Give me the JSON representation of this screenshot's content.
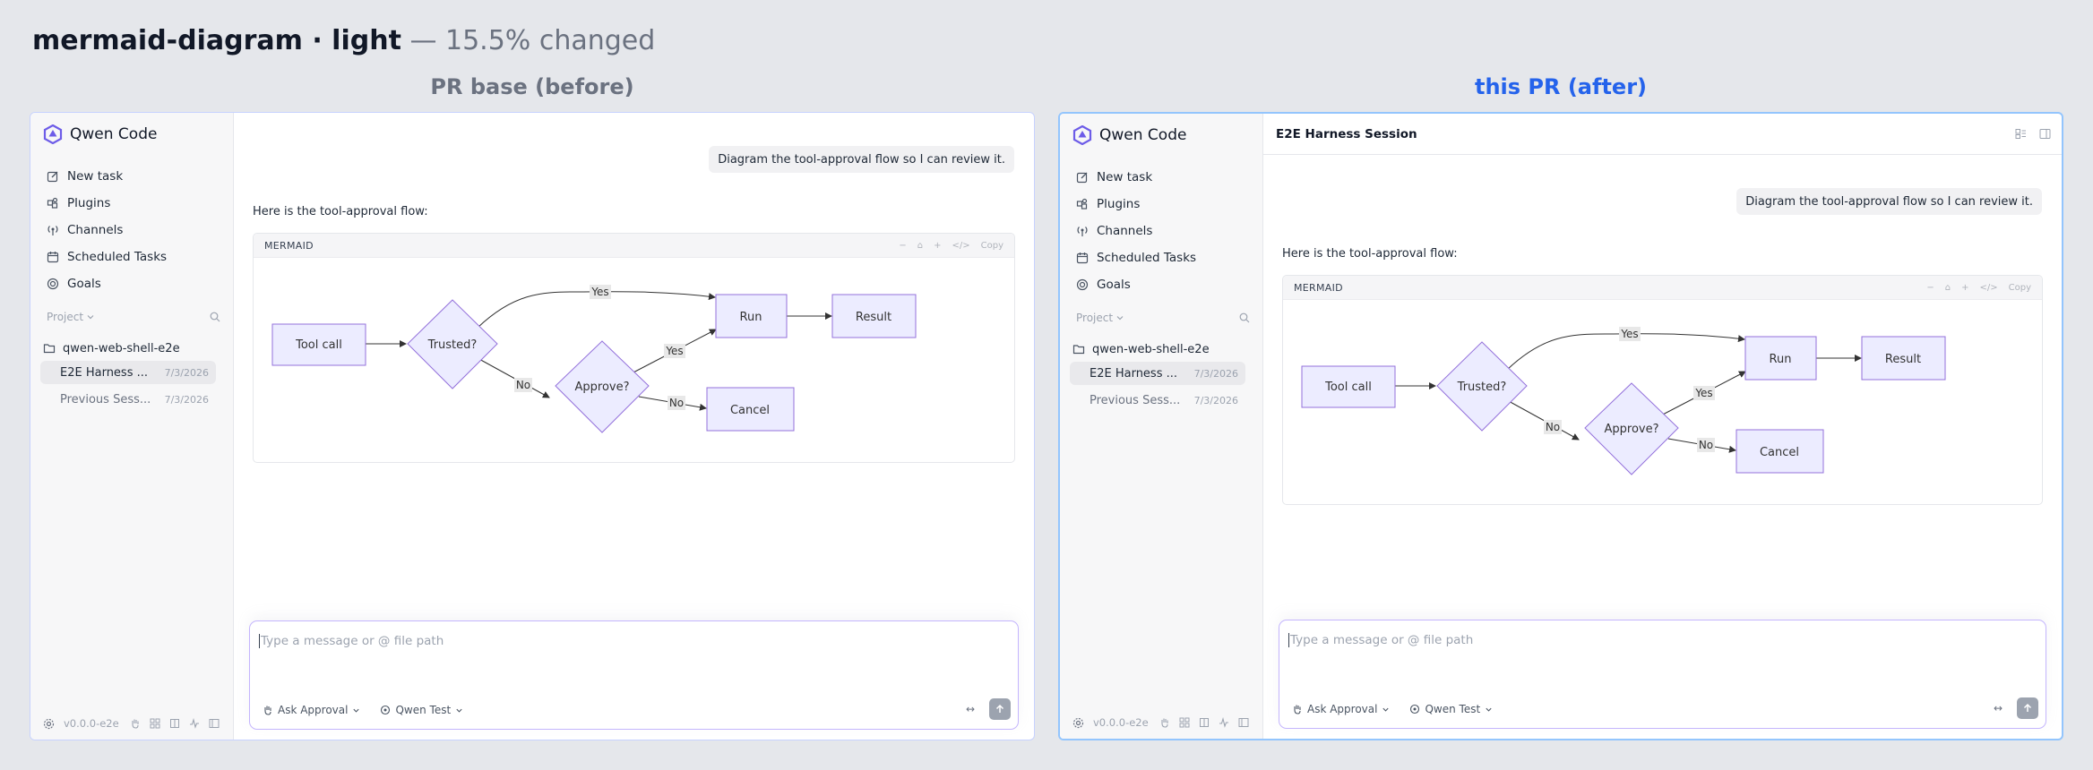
{
  "heading": {
    "main": "mermaid-diagram · light",
    "sub": " — 15.5% changed"
  },
  "columns": {
    "before": "PR base (before)",
    "after": "this PR (after)"
  },
  "app": {
    "brand": "Qwen Code",
    "nav": [
      "New task",
      "Plugins",
      "Channels",
      "Scheduled Tasks",
      "Goals"
    ],
    "section_label": "Project",
    "project": "qwen-web-shell-e2e",
    "sessions": [
      {
        "title": "E2E Harness ...",
        "date": "7/3/2026"
      },
      {
        "title": "Previous Sess...",
        "date": "7/3/2026"
      }
    ],
    "version": "v0.0.0-e2e",
    "session_header": "E2E Harness Session",
    "user_message": "Diagram the tool-approval flow so I can review it.",
    "reply": "Here is the tool-approval flow:",
    "code_lang": "MERMAID",
    "code_tools": [
      "−",
      "⌂",
      "+",
      "</>",
      "Copy"
    ],
    "composer": {
      "placeholder": "Type a message or @ file path",
      "mode": "Ask Approval",
      "model": "Qwen Test",
      "expand": "↔"
    },
    "flow": {
      "nodes": [
        "Tool call",
        "Trusted?",
        "Approve?",
        "Run",
        "Result",
        "Cancel"
      ],
      "edge_labels": [
        "Yes",
        "No",
        "Yes",
        "No"
      ]
    }
  },
  "colors": {
    "accent": "#2563eb",
    "node_fill": "#ececff",
    "node_stroke": "#9370db",
    "muted": "#6b7280"
  }
}
